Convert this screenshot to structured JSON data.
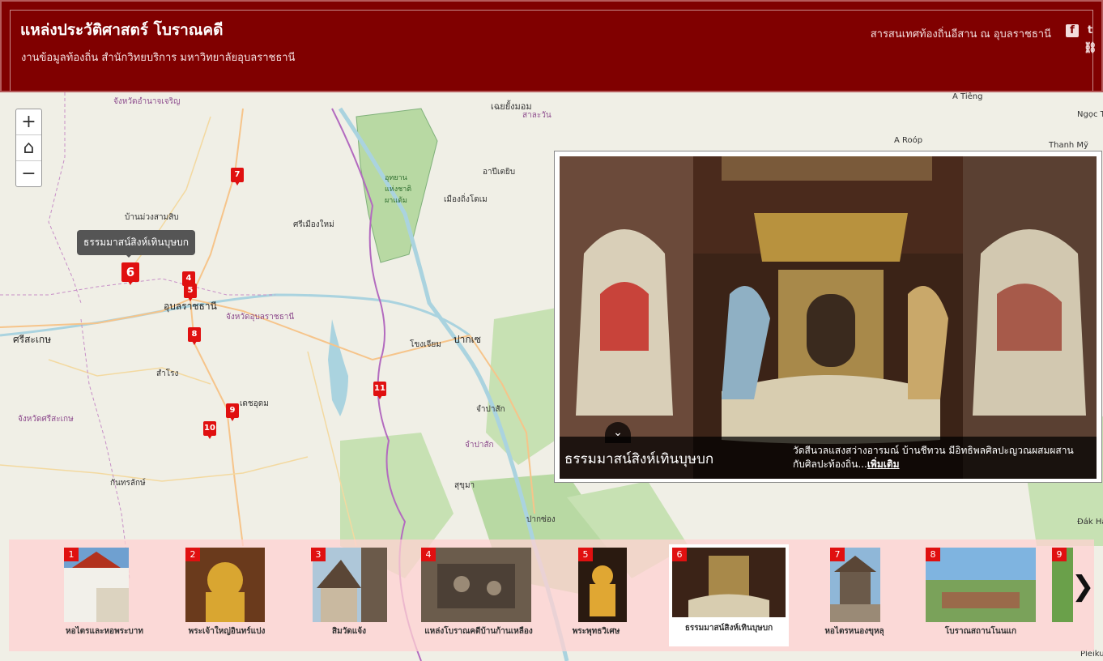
{
  "header": {
    "title": "แหล่งประวัติศาสตร์ โบราณคดี",
    "subtitle": "งานข้อมูลท้องถิ่น สำนักวิทยบริการ มหาวิทยาลัยอุบลราชธานี",
    "org": "สารสนเทศท้องถิ่นอีสาน ณ อุบลราชธานี",
    "facebook_icon": "f",
    "twitter_icon": "t",
    "link_icon": "⛓"
  },
  "zoom": {
    "in": "+",
    "home": "⌂",
    "out": "−"
  },
  "map_labels": [
    {
      "text": "จังหวัดอำนาจเจริญ",
      "kind": "prov"
    },
    {
      "text": "เฉยยั้งมอม",
      "kind": "normal"
    },
    {
      "text": "สาละวัน",
      "kind": "prov"
    },
    {
      "text": "อาปีเตยิบ",
      "kind": "normal"
    },
    {
      "text": "A Tiêng",
      "kind": "normal"
    },
    {
      "text": "A Roóp",
      "kind": "normal"
    },
    {
      "text": "Thanh Mỹ",
      "kind": "normal"
    },
    {
      "text": "Ngọc Tiền",
      "kind": "normal"
    },
    {
      "text": "อุทยาน แห่งชาติ ผาแต้ม",
      "kind": "park"
    },
    {
      "text": "เมืองถิ่งโดเม",
      "kind": "normal"
    },
    {
      "text": "บ้านม่วงสามสิบ",
      "kind": "normal"
    },
    {
      "text": "ศรีเมืองใหม่",
      "kind": "normal"
    },
    {
      "text": "อุบลราชธานี",
      "kind": "big"
    },
    {
      "text": "จังหวัดอุบลราชธานี",
      "kind": "prov"
    },
    {
      "text": "ศรีสะเกษ",
      "kind": "big"
    },
    {
      "text": "ปากเซ",
      "kind": "big"
    },
    {
      "text": "โขงเจียม",
      "kind": "normal"
    },
    {
      "text": "สำโรง",
      "kind": "normal"
    },
    {
      "text": "เดชอุดม",
      "kind": "normal"
    },
    {
      "text": "จังหวัดศรีสะเกษ",
      "kind": "prov"
    },
    {
      "text": "จำปาสัก",
      "kind": "normal"
    },
    {
      "text": "จำปาสัก",
      "kind": "prov"
    },
    {
      "text": "กันทรลักษ์",
      "kind": "normal"
    },
    {
      "text": "สุขุมา",
      "kind": "normal"
    },
    {
      "text": "ปากซ่อง",
      "kind": "normal"
    },
    {
      "text": "Đák Hà",
      "kind": "normal"
    },
    {
      "text": "Pleiku",
      "kind": "normal"
    }
  ],
  "markers": [
    "7",
    "6",
    "4",
    "5",
    "8",
    "11",
    "9",
    "10"
  ],
  "tooltip": "ธรรมมาสน์สิงห์เทินบุษบก",
  "popup": {
    "title": "ธรรมมาสน์สิงห์เทินบุษบก",
    "description": "วัดสีนวลแสงสว่างอารมณ์ บ้านชีทวน มีอิทธิพลศิลปะญวณผสมผสานกับศิลปะท้องถิ่น...",
    "more": "เพิ่มเติม",
    "collapse_icon": "⌄"
  },
  "carousel": {
    "items": [
      {
        "num": "1",
        "label": "หอไตรและหอพระบาท"
      },
      {
        "num": "2",
        "label": "พระเจ้าใหญ่อินทร์แปง"
      },
      {
        "num": "3",
        "label": "สิมวัดแจ้ง"
      },
      {
        "num": "4",
        "label": "แหล่งโบราณคดีบ้านก้านเหลือง"
      },
      {
        "num": "5",
        "label": "พระพุทธวิเศษ"
      },
      {
        "num": "6",
        "label": "ธรรมมาสน์สิงห์เทินบุษบก"
      },
      {
        "num": "7",
        "label": "หอไตรหนองขุหลุ"
      },
      {
        "num": "8",
        "label": "โบราณสถานโนนแก"
      },
      {
        "num": "9",
        "label": ""
      }
    ],
    "next_icon": "❯",
    "active_index": 5
  }
}
